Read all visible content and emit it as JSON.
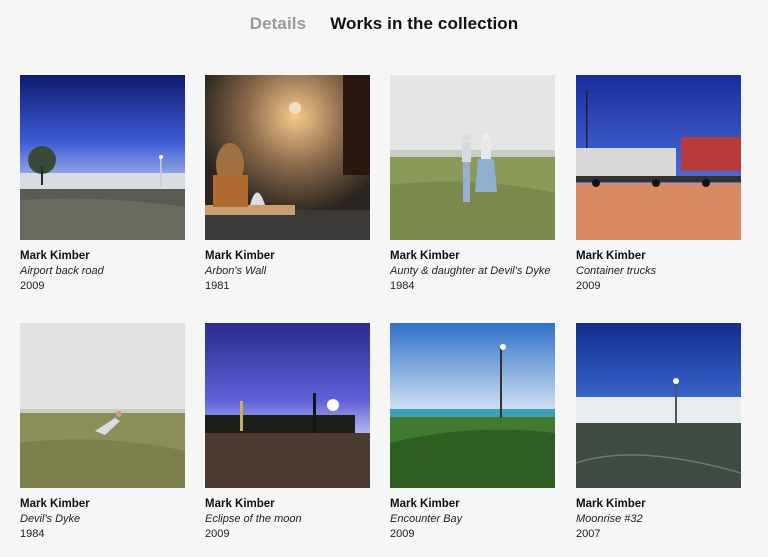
{
  "tabs": [
    {
      "label": "Details",
      "active": false
    },
    {
      "label": "Works in the collection",
      "active": true
    }
  ],
  "works": [
    {
      "artist": "Mark Kimber",
      "title": "Airport back road",
      "year": "2009"
    },
    {
      "artist": "Mark Kimber",
      "title": "Arbon's Wall",
      "year": "1981"
    },
    {
      "artist": "Mark Kimber",
      "title": "Aunty & daughter at Devil's Dyke",
      "year": "1984"
    },
    {
      "artist": "Mark Kimber",
      "title": "Container trucks",
      "year": "2009"
    },
    {
      "artist": "Mark Kimber",
      "title": "Devil's Dyke",
      "year": "1984"
    },
    {
      "artist": "Mark Kimber",
      "title": "Eclipse of the moon",
      "year": "2009"
    },
    {
      "artist": "Mark Kimber",
      "title": "Encounter Bay",
      "year": "2009"
    },
    {
      "artist": "Mark Kimber",
      "title": "Moonrise #32",
      "year": "2007"
    }
  ]
}
